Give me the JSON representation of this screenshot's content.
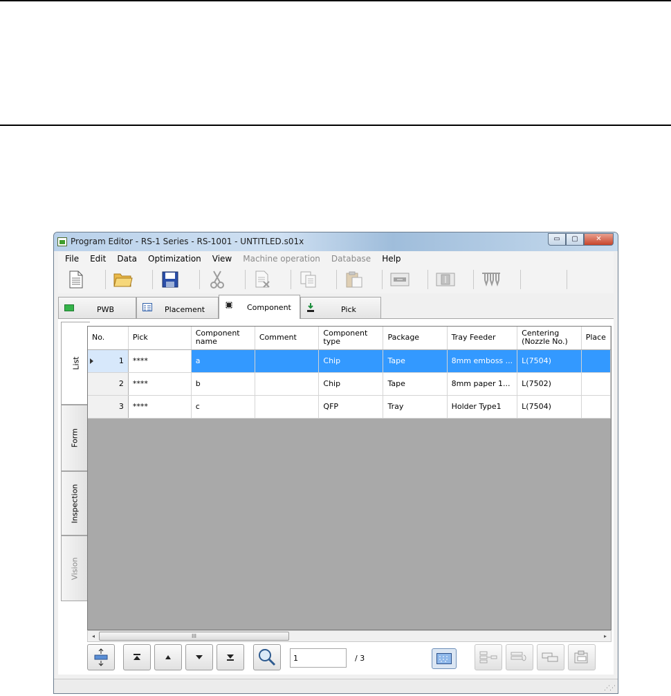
{
  "window": {
    "title": "Program Editor - RS-1 Series - RS-1001 - UNTITLED.s01x",
    "minimize": "▭",
    "maximize": "▢",
    "close": "✕"
  },
  "menu": [
    "File",
    "Edit",
    "Data",
    "Optimization",
    "View",
    "Machine operation",
    "Database",
    "Help"
  ],
  "toolbar_icons": [
    "new-file-icon",
    "open-folder-icon",
    "save-icon",
    "cut-icon",
    "delete-icon",
    "copy-icon",
    "paste-icon",
    "conveyor-icon",
    "board-icon",
    "nozzle-icon"
  ],
  "top_tabs": {
    "pwb": "PWB",
    "placement": "Placement",
    "component": "Component",
    "pick": "Pick"
  },
  "side_tabs": {
    "list": "List",
    "form": "Form",
    "inspection": "Inspection",
    "vision": "Vision"
  },
  "grid": {
    "columns": [
      "No.",
      "Pick",
      "Component name",
      "Comment",
      "Component type",
      "Package",
      "Tray Feeder",
      "Centering (Nozzle No.)",
      "Place"
    ],
    "rows": [
      {
        "no": "1",
        "pick": "****",
        "name": "a",
        "comment": "",
        "type": "Chip",
        "package": "Tape",
        "tray": "8mm emboss ...",
        "centering": "L(7504)",
        "place": ""
      },
      {
        "no": "2",
        "pick": "****",
        "name": "b",
        "comment": "",
        "type": "Chip",
        "package": "Tape",
        "tray": "8mm paper 1...",
        "centering": "L(7502)",
        "place": ""
      },
      {
        "no": "3",
        "pick": "****",
        "name": "c",
        "comment": "",
        "type": "QFP",
        "package": "Tray",
        "tray": "Holder Type1",
        "centering": "L(7504)",
        "place": ""
      }
    ],
    "selected_row": 1
  },
  "scrollbar": {
    "left": "◂",
    "right": "▸",
    "grip": "III"
  },
  "nav": {
    "current_page": "1",
    "total": "/ 3"
  },
  "colors": {
    "selection": "#3399ff",
    "empty_grid": "#a9a9a9"
  }
}
